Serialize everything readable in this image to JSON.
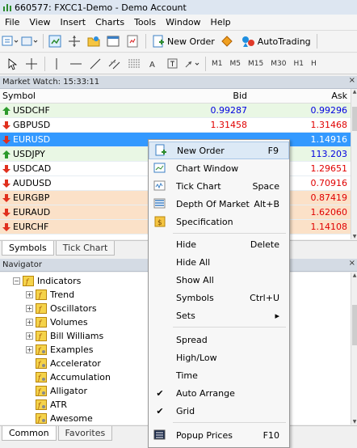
{
  "window": {
    "title": "660577: FXCC1-Demo - Demo Account"
  },
  "menubar": {
    "items": [
      "File",
      "View",
      "Insert",
      "Charts",
      "Tools",
      "Window",
      "Help"
    ]
  },
  "toolbar": {
    "new_order": "New Order",
    "auto_trading": "AutoTrading"
  },
  "timeframes": [
    "M1",
    "M5",
    "M15",
    "M30",
    "H1",
    "H"
  ],
  "market_watch": {
    "title": "Market Watch: 15:33:11",
    "headers": {
      "symbol": "Symbol",
      "bid": "Bid",
      "ask": "Ask"
    },
    "rows": [
      {
        "symbol": "USDCHF",
        "bid": "0.99287",
        "ask": "0.99296",
        "dir": "up"
      },
      {
        "symbol": "GBPUSD",
        "bid": "1.31458",
        "ask": "1.31468",
        "dir": "down"
      },
      {
        "symbol": "EURUSD",
        "bid": "",
        "ask": "1.14916",
        "dir": "down"
      },
      {
        "symbol": "USDJPY",
        "bid": "",
        "ask": "113.203",
        "dir": "up"
      },
      {
        "symbol": "USDCAD",
        "bid": "",
        "ask": "1.29651",
        "dir": "down"
      },
      {
        "symbol": "AUDUSD",
        "bid": "",
        "ask": "0.70916",
        "dir": "down"
      },
      {
        "symbol": "EURGBP",
        "bid": "",
        "ask": "0.87419",
        "dir": "down"
      },
      {
        "symbol": "EURAUD",
        "bid": "",
        "ask": "1.62060",
        "dir": "down"
      },
      {
        "symbol": "EURCHF",
        "bid": "",
        "ask": "1.14108",
        "dir": "down"
      }
    ],
    "tabs": [
      "Symbols",
      "Tick Chart"
    ]
  },
  "navigator": {
    "title": "Navigator",
    "nodes": [
      {
        "label": "Indicators",
        "level": 0,
        "expander": "−"
      },
      {
        "label": "Trend",
        "level": 1,
        "expander": "+"
      },
      {
        "label": "Oscillators",
        "level": 1,
        "expander": "+"
      },
      {
        "label": "Volumes",
        "level": 1,
        "expander": "+"
      },
      {
        "label": "Bill Williams",
        "level": 1,
        "expander": "+"
      },
      {
        "label": "Examples",
        "level": 1,
        "expander": "+"
      },
      {
        "label": "Accelerator",
        "level": 2,
        "expander": ""
      },
      {
        "label": "Accumulation",
        "level": 2,
        "expander": ""
      },
      {
        "label": "Alligator",
        "level": 2,
        "expander": ""
      },
      {
        "label": "ATR",
        "level": 2,
        "expander": ""
      },
      {
        "label": "Awesome",
        "level": 2,
        "expander": ""
      }
    ],
    "tabs": [
      "Common",
      "Favorites"
    ]
  },
  "context_menu": {
    "items": [
      {
        "label": "New Order",
        "key": "F9",
        "icon": "new-order-icon",
        "checked": false
      },
      {
        "label": "Chart Window",
        "key": "",
        "icon": "chart-window-icon",
        "checked": false
      },
      {
        "label": "Tick Chart",
        "key": "Space",
        "icon": "tick-chart-icon",
        "checked": false
      },
      {
        "label": "Depth Of Market",
        "key": "Alt+B",
        "icon": "depth-of-market-icon",
        "checked": false
      },
      {
        "label": "Specification",
        "key": "",
        "icon": "specification-icon",
        "checked": false
      },
      {
        "label": "Hide",
        "key": "Delete",
        "icon": "",
        "checked": false
      },
      {
        "label": "Hide All",
        "key": "",
        "icon": "",
        "checked": false
      },
      {
        "label": "Show All",
        "key": "",
        "icon": "",
        "checked": false
      },
      {
        "label": "Symbols",
        "key": "Ctrl+U",
        "icon": "",
        "checked": false
      },
      {
        "label": "Sets",
        "key": "▸",
        "icon": "",
        "checked": false
      },
      {
        "label": "Spread",
        "key": "",
        "icon": "",
        "checked": false
      },
      {
        "label": "High/Low",
        "key": "",
        "icon": "",
        "checked": false
      },
      {
        "label": "Time",
        "key": "",
        "icon": "",
        "checked": false
      },
      {
        "label": "Auto Arrange",
        "key": "",
        "icon": "",
        "checked": true
      },
      {
        "label": "Grid",
        "key": "",
        "icon": "",
        "checked": true
      },
      {
        "label": "Popup Prices",
        "key": "F10",
        "icon": "popup-prices-icon",
        "checked": false
      }
    ]
  },
  "colors": {
    "up": "#0000e0",
    "down": "#e00000",
    "selected": "#3399ff",
    "row_green": "#e9f7e4",
    "row_orange": "#fbe1c8"
  }
}
